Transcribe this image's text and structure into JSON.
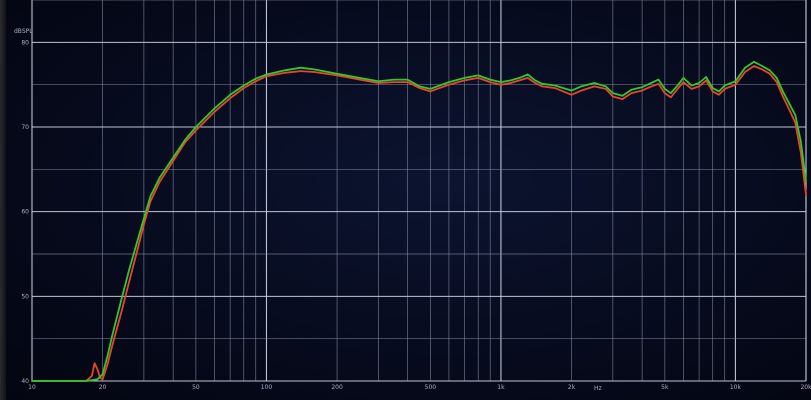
{
  "chart_data": {
    "type": "line",
    "title": "",
    "ylabel": "dBSPL",
    "xlabel": "Hz",
    "x_scale": "log",
    "xlim": [
      10,
      20000
    ],
    "ylim": [
      40,
      85
    ],
    "grid": true,
    "x_tick_labels": [
      {
        "value": 10,
        "label": "10"
      },
      {
        "value": 20,
        "label": "20"
      },
      {
        "value": 50,
        "label": "50"
      },
      {
        "value": 100,
        "label": "100"
      },
      {
        "value": 200,
        "label": "200"
      },
      {
        "value": 500,
        "label": "500"
      },
      {
        "value": 1000,
        "label": "1k"
      },
      {
        "value": 2000,
        "label": "2k"
      },
      {
        "value": 5000,
        "label": "5k"
      },
      {
        "value": 10000,
        "label": "10k"
      },
      {
        "value": 20000,
        "label": "20k"
      }
    ],
    "y_tick_labels": [
      {
        "value": 40,
        "label": "40"
      },
      {
        "value": 50,
        "label": "50"
      },
      {
        "value": 60,
        "label": "60"
      },
      {
        "value": 70,
        "label": "70"
      },
      {
        "value": 80,
        "label": "80"
      }
    ],
    "series": [
      {
        "color": "#e8462a",
        "points": [
          [
            10,
            40
          ],
          [
            14,
            40
          ],
          [
            17,
            40
          ],
          [
            18,
            40.6
          ],
          [
            18.5,
            42.1
          ],
          [
            19,
            41.4
          ],
          [
            19.5,
            40.4
          ],
          [
            20,
            40.2
          ],
          [
            21,
            42
          ],
          [
            22,
            44.2
          ],
          [
            24,
            48
          ],
          [
            26,
            51.8
          ],
          [
            28,
            55.2
          ],
          [
            30,
            58.5
          ],
          [
            32,
            61.2
          ],
          [
            35,
            63.5
          ],
          [
            40,
            66
          ],
          [
            45,
            68.2
          ],
          [
            50,
            69.6
          ],
          [
            60,
            71.8
          ],
          [
            70,
            73.4
          ],
          [
            80,
            74.6
          ],
          [
            90,
            75.4
          ],
          [
            100,
            76
          ],
          [
            120,
            76.4
          ],
          [
            140,
            76.6
          ],
          [
            160,
            76.5
          ],
          [
            200,
            76.1
          ],
          [
            250,
            75.6
          ],
          [
            300,
            75.2
          ],
          [
            350,
            75.3
          ],
          [
            400,
            75.3
          ],
          [
            450,
            74.6
          ],
          [
            500,
            74.2
          ],
          [
            600,
            75
          ],
          [
            700,
            75.5
          ],
          [
            800,
            75.8
          ],
          [
            900,
            75.3
          ],
          [
            1000,
            75
          ],
          [
            1100,
            75.2
          ],
          [
            1200,
            75.5
          ],
          [
            1300,
            75.8
          ],
          [
            1400,
            75.2
          ],
          [
            1500,
            74.8
          ],
          [
            1700,
            74.6
          ],
          [
            2000,
            73.8
          ],
          [
            2200,
            74.3
          ],
          [
            2500,
            74.8
          ],
          [
            2800,
            74.5
          ],
          [
            3000,
            73.6
          ],
          [
            3300,
            73.3
          ],
          [
            3600,
            74
          ],
          [
            4000,
            74.3
          ],
          [
            4300,
            74.7
          ],
          [
            4700,
            75.1
          ],
          [
            5000,
            74
          ],
          [
            5300,
            73.5
          ],
          [
            5700,
            74.6
          ],
          [
            6000,
            75.3
          ],
          [
            6500,
            74.5
          ],
          [
            7000,
            74.8
          ],
          [
            7500,
            75.5
          ],
          [
            8000,
            74.2
          ],
          [
            8500,
            73.8
          ],
          [
            9000,
            74.5
          ],
          [
            10000,
            75
          ],
          [
            11000,
            76.5
          ],
          [
            12000,
            77.2
          ],
          [
            13000,
            76.8
          ],
          [
            14000,
            76.3
          ],
          [
            15000,
            75.3
          ],
          [
            16000,
            73.5
          ],
          [
            17000,
            72
          ],
          [
            18000,
            70.5
          ],
          [
            19000,
            67
          ],
          [
            20000,
            62
          ]
        ]
      },
      {
        "color": "#31c92b",
        "points": [
          [
            10,
            40
          ],
          [
            14,
            40
          ],
          [
            17,
            40
          ],
          [
            18,
            40.1
          ],
          [
            19,
            40.2
          ],
          [
            19.5,
            40.5
          ],
          [
            20,
            40.8
          ],
          [
            21,
            43
          ],
          [
            22,
            45.4
          ],
          [
            24,
            49.5
          ],
          [
            26,
            53.2
          ],
          [
            28,
            56.3
          ],
          [
            30,
            59.2
          ],
          [
            32,
            61.8
          ],
          [
            35,
            64
          ],
          [
            40,
            66.4
          ],
          [
            45,
            68.5
          ],
          [
            50,
            70
          ],
          [
            60,
            72.2
          ],
          [
            70,
            73.8
          ],
          [
            80,
            74.9
          ],
          [
            90,
            75.7
          ],
          [
            100,
            76.2
          ],
          [
            120,
            76.7
          ],
          [
            140,
            77
          ],
          [
            160,
            76.8
          ],
          [
            200,
            76.3
          ],
          [
            250,
            75.8
          ],
          [
            300,
            75.4
          ],
          [
            350,
            75.6
          ],
          [
            400,
            75.6
          ],
          [
            450,
            74.8
          ],
          [
            500,
            74.5
          ],
          [
            600,
            75.3
          ],
          [
            700,
            75.8
          ],
          [
            800,
            76.1
          ],
          [
            900,
            75.6
          ],
          [
            1000,
            75.3
          ],
          [
            1100,
            75.5
          ],
          [
            1200,
            75.8
          ],
          [
            1300,
            76.2
          ],
          [
            1400,
            75.5
          ],
          [
            1500,
            75.1
          ],
          [
            1700,
            74.9
          ],
          [
            2000,
            74.3
          ],
          [
            2200,
            74.8
          ],
          [
            2500,
            75.2
          ],
          [
            2800,
            74.8
          ],
          [
            3000,
            74
          ],
          [
            3300,
            73.7
          ],
          [
            3600,
            74.4
          ],
          [
            4000,
            74.7
          ],
          [
            4300,
            75.1
          ],
          [
            4700,
            75.6
          ],
          [
            5000,
            74.5
          ],
          [
            5300,
            74
          ],
          [
            5700,
            75
          ],
          [
            6000,
            75.8
          ],
          [
            6500,
            74.9
          ],
          [
            7000,
            75.2
          ],
          [
            7500,
            75.9
          ],
          [
            8000,
            74.6
          ],
          [
            8500,
            74.2
          ],
          [
            9000,
            74.9
          ],
          [
            10000,
            75.4
          ],
          [
            11000,
            77
          ],
          [
            12000,
            77.7
          ],
          [
            13000,
            77.2
          ],
          [
            14000,
            76.7
          ],
          [
            15000,
            75.8
          ],
          [
            16000,
            74.1
          ],
          [
            17000,
            72.7
          ],
          [
            18000,
            71.4
          ],
          [
            19000,
            68.3
          ],
          [
            20000,
            63.6
          ]
        ]
      }
    ]
  }
}
